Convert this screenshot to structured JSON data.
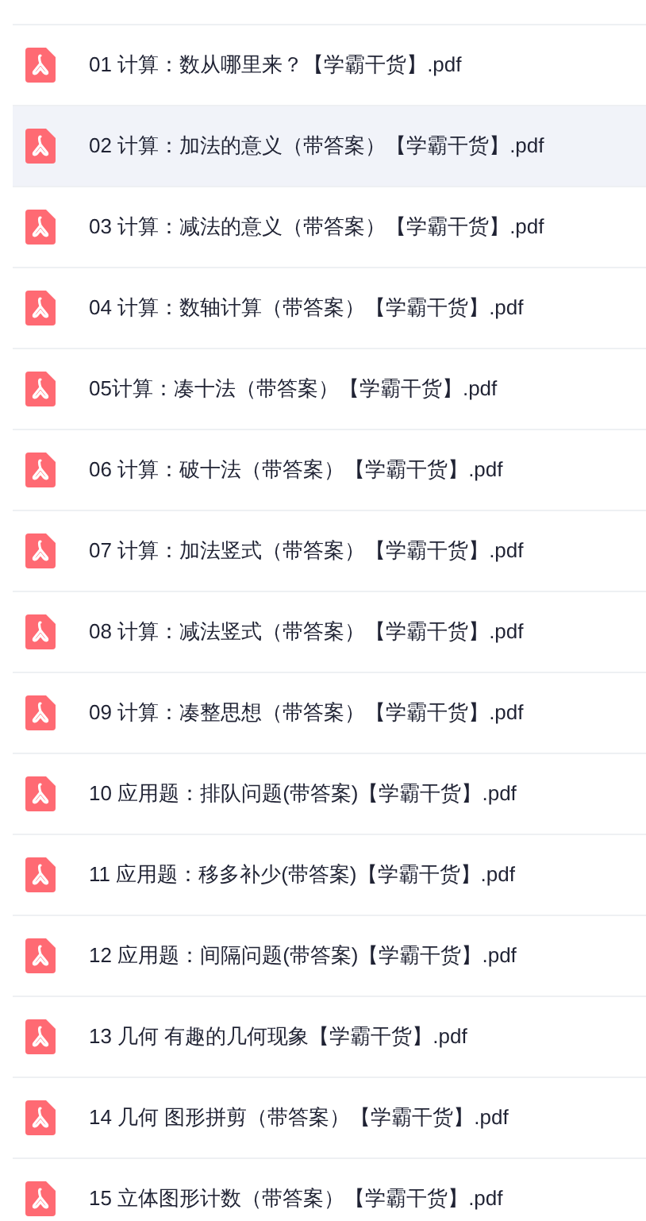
{
  "files": [
    {
      "name": "01 计算：数从哪里来？【学霸干货】.pdf",
      "selected": false
    },
    {
      "name": "02 计算：加法的意义（带答案）【学霸干货】.pdf",
      "selected": true
    },
    {
      "name": "03 计算：减法的意义（带答案）【学霸干货】.pdf",
      "selected": false
    },
    {
      "name": "04 计算：数轴计算（带答案）【学霸干货】.pdf",
      "selected": false
    },
    {
      "name": "05计算：凑十法（带答案）【学霸干货】.pdf",
      "selected": false
    },
    {
      "name": "06 计算：破十法（带答案）【学霸干货】.pdf",
      "selected": false
    },
    {
      "name": "07 计算：加法竖式（带答案）【学霸干货】.pdf",
      "selected": false
    },
    {
      "name": "08 计算：减法竖式（带答案）【学霸干货】.pdf",
      "selected": false
    },
    {
      "name": "09 计算：凑整思想（带答案）【学霸干货】.pdf",
      "selected": false
    },
    {
      "name": "10 应用题：排队问题(带答案)【学霸干货】.pdf",
      "selected": false
    },
    {
      "name": "11 应用题：移多补少(带答案)【学霸干货】.pdf",
      "selected": false
    },
    {
      "name": "12 应用题：间隔问题(带答案)【学霸干货】.pdf",
      "selected": false
    },
    {
      "name": "13 几何 有趣的几何现象【学霸干货】.pdf",
      "selected": false
    },
    {
      "name": "14 几何 图形拼剪（带答案）【学霸干货】.pdf",
      "selected": false
    },
    {
      "name": "15 立体图形计数（带答案）【学霸干货】.pdf",
      "selected": false
    }
  ]
}
